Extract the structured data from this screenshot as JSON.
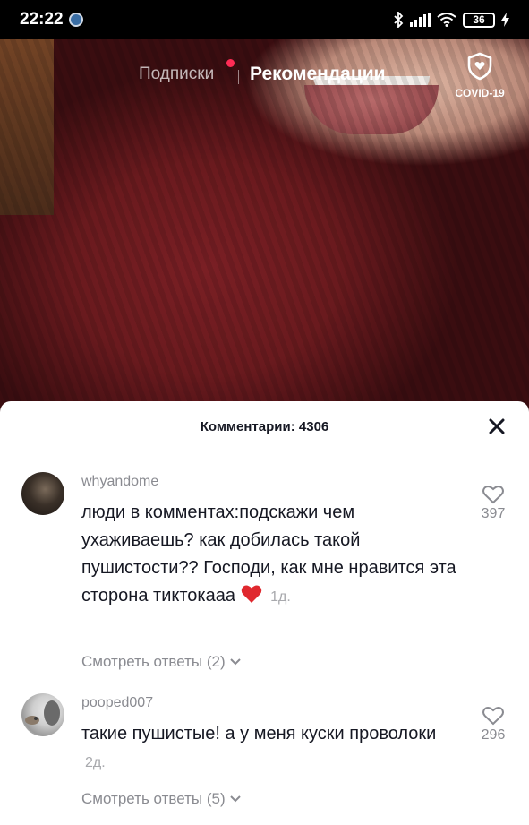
{
  "status_bar": {
    "time": "22:22",
    "battery": "36"
  },
  "top_nav": {
    "following": "Подписки",
    "for_you": "Рекомендации",
    "covid_label": "COVID-19"
  },
  "comments_sheet": {
    "title": "Комментарии: 4306",
    "comments": [
      {
        "username": "whyandome",
        "text": "люди в комментах:подскажи чем ухаживаешь? как добилась такой пушистости?? Господи, как мне нравится эта сторона тиктокааа",
        "emoji": "red-heart",
        "time_ago": "1д.",
        "likes": "397",
        "view_replies": "Смотреть ответы (2)"
      },
      {
        "username": "pooped007",
        "text": "такие пушистые! а у меня куски проволоки",
        "time_ago": "2д.",
        "likes": "296",
        "view_replies": "Смотреть ответы (5)"
      }
    ]
  },
  "colors": {
    "accent_live": "#fe2c55",
    "muted_text": "#8a8b91",
    "primary_text": "#161823"
  }
}
